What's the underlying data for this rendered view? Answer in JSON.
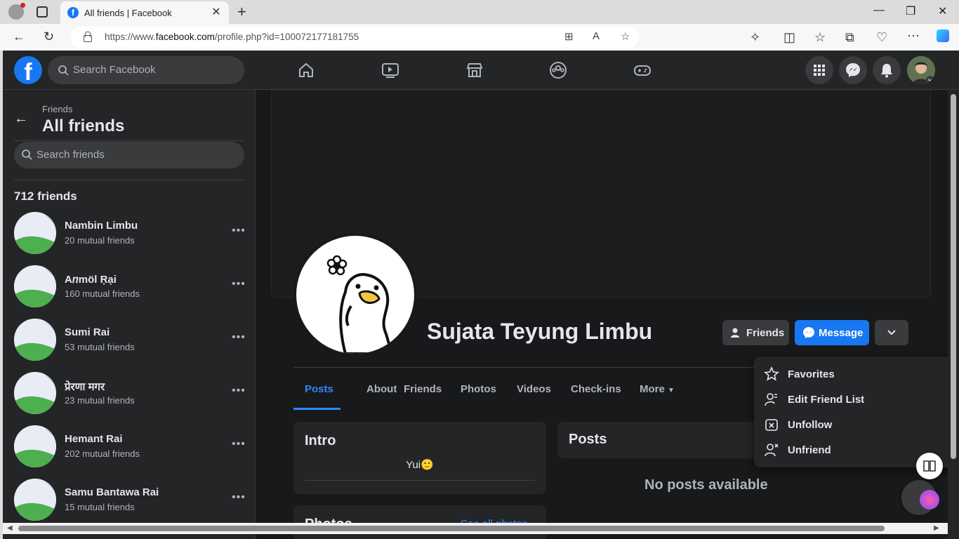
{
  "browser": {
    "tab_title": "All friends | Facebook",
    "url_prefix": "https://www.",
    "url_domain": "facebook.com",
    "url_path": "/profile.php?id=100072177181755"
  },
  "header": {
    "search_placeholder": "Search Facebook",
    "logo": "f"
  },
  "sidebar": {
    "breadcrumb": "Friends",
    "title": "All friends",
    "search_placeholder": "Search friends",
    "count": "712 friends",
    "friends": [
      {
        "name": "Nambin Limbu",
        "mutual": "20 mutual friends"
      },
      {
        "name": "Aⴖmöl Ŗại",
        "mutual": "160 mutual friends"
      },
      {
        "name": "Sumi Rai",
        "mutual": "53 mutual friends"
      },
      {
        "name": "प्रेरणा मगर",
        "mutual": "23 mutual friends"
      },
      {
        "name": "Hemant Rai",
        "mutual": "202 mutual friends"
      },
      {
        "name": "Samu Bantawa Rai",
        "mutual": "15 mutual friends"
      }
    ],
    "more_glyph": "•••"
  },
  "profile": {
    "name": "Sujata Teyung Limbu",
    "friends_button": "Friends",
    "message_button": "Message",
    "tabs": [
      "Posts",
      "About",
      "Friends",
      "Photos",
      "Videos",
      "Check-ins",
      "More"
    ],
    "more_caret": "▼",
    "intro_title": "Intro",
    "bio": "Yui🙂",
    "photos_title": "Photos",
    "see_all_photos": "See all photos",
    "posts_title": "Posts",
    "no_posts": "No posts available"
  },
  "dropdown": {
    "items": [
      {
        "label": "Favorites",
        "icon": "star-icon"
      },
      {
        "label": "Edit Friend List",
        "icon": "edit-friend-list-icon"
      },
      {
        "label": "Unfollow",
        "icon": "unfollow-icon"
      },
      {
        "label": "Unfriend",
        "icon": "unfriend-icon"
      }
    ]
  },
  "colors": {
    "accent": "#1877f2",
    "background": "#18191a",
    "surface": "#242526"
  }
}
